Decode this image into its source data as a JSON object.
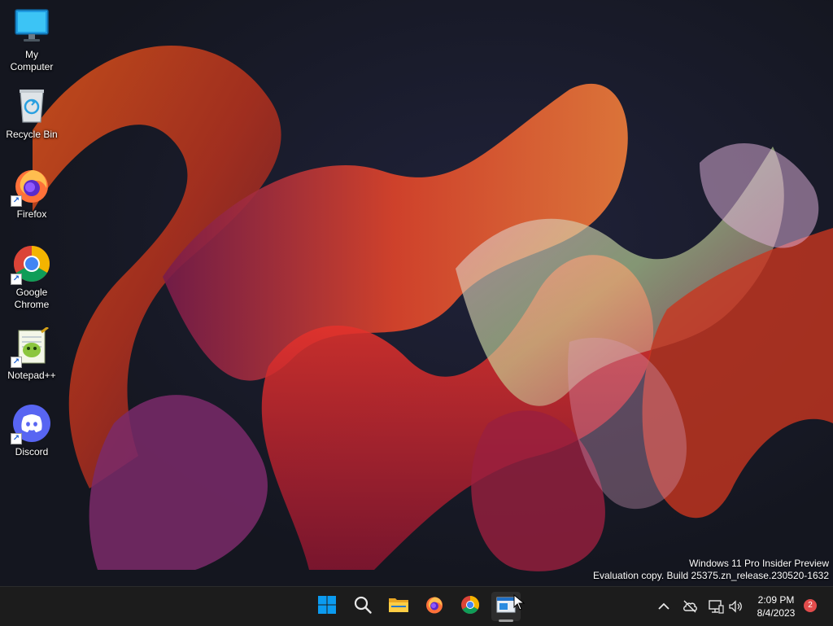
{
  "desktop": {
    "icons": [
      {
        "label": "My Computer",
        "icon": "monitor-icon"
      },
      {
        "label": "Recycle Bin",
        "icon": "recycle-bin-icon"
      },
      {
        "label": "Firefox",
        "icon": "firefox-icon"
      },
      {
        "label": "Google Chrome",
        "icon": "chrome-icon"
      },
      {
        "label": "Notepad++",
        "icon": "notepad-plus-plus-icon"
      },
      {
        "label": "Discord",
        "icon": "discord-icon"
      }
    ],
    "watermark": {
      "line1": "Windows 11 Pro Insider Preview",
      "line2": "Evaluation copy. Build 25375.zn_release.230520-1632"
    }
  },
  "taskbar": {
    "items": [
      {
        "name": "start",
        "icon": "windows-logo-icon"
      },
      {
        "name": "search",
        "icon": "search-icon"
      },
      {
        "name": "file-explorer",
        "icon": "folder-icon"
      },
      {
        "name": "firefox",
        "icon": "firefox-icon"
      },
      {
        "name": "chrome",
        "icon": "chrome-icon"
      },
      {
        "name": "active-app",
        "icon": "app-window-icon",
        "active": true
      }
    ],
    "tray": {
      "icons": [
        "chevron-up-icon",
        "cloud-off-icon",
        "network-icon",
        "speaker-icon"
      ],
      "time": "2:09 PM",
      "date": "8/4/2023",
      "notification_count": "2"
    }
  },
  "colors": {
    "taskbar_bg": "#1c1c1c",
    "wallpaper_bg": "#161823",
    "accent_blue": "#0078d4",
    "badge_red": "#e24c4c"
  }
}
